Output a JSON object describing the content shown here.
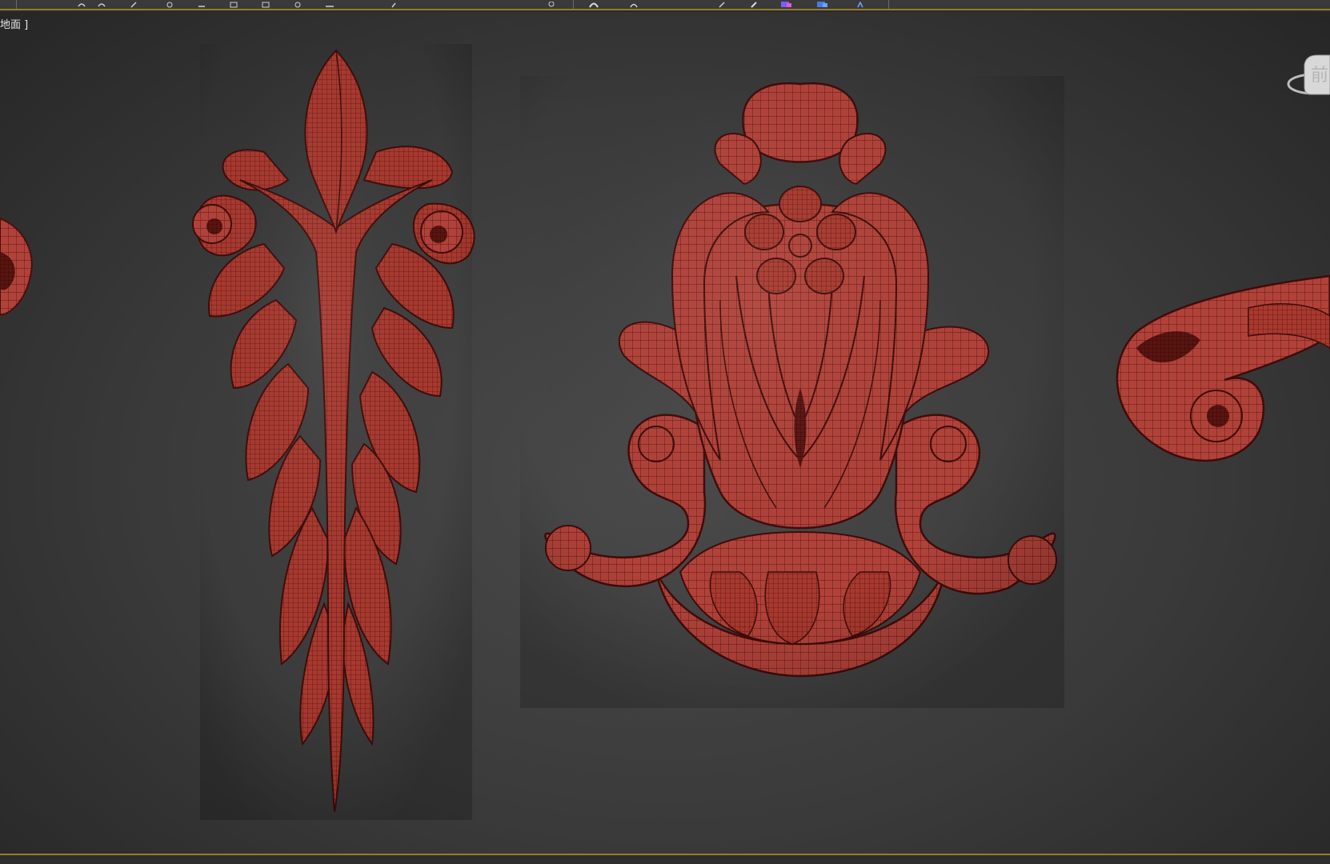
{
  "viewport": {
    "label": "地面 ]"
  },
  "viewcube": {
    "face_label": "前"
  },
  "toolbar": {
    "accent_color": "#9a7a2a",
    "icons": [
      "undo-icon",
      "redo-icon",
      "link-icon",
      "unlink-icon",
      "bind-icon",
      "select-icon",
      "select-region-icon",
      "window-crossing-icon",
      "move-icon",
      "rotate-icon",
      "scale-icon",
      "snap-icon",
      "angle-snap-icon",
      "percent-snap-icon",
      "mirror-icon",
      "align-icon",
      "layer-icon"
    ]
  },
  "scene": {
    "material_color": "#a83a32",
    "objects": [
      "carved-scroll-left-fragment",
      "carved-acanthus-leaf-pendant",
      "carved-baroque-cartouche",
      "carved-scroll-right-fragment"
    ]
  }
}
